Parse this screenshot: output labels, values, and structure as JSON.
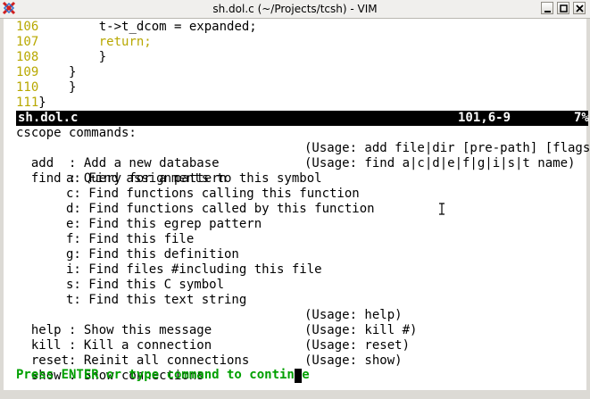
{
  "window": {
    "title": "sh.dol.c (~/Projects/tcsh) - VIM",
    "app_icon": "vim-icon",
    "controls": [
      "minimize-icon",
      "maximize-icon",
      "close-icon"
    ]
  },
  "code_lines": [
    {
      "num": "106",
      "text": "        t->t_dcom = expanded;"
    },
    {
      "num": "107",
      "text": "        return;",
      "keyword": true
    },
    {
      "num": "108",
      "text": "        }"
    },
    {
      "num": "109",
      "text": "    }"
    },
    {
      "num": "110",
      "text": "    }"
    },
    {
      "num": "111",
      "text": "}"
    }
  ],
  "statusline": {
    "filename": "sh.dol.c",
    "position": "101,6-9",
    "percent": "7%"
  },
  "cscope": {
    "header": "cscope commands:",
    "commands": [
      {
        "name": "add  : Add a new database",
        "usage": "(Usage: add file|dir [pre-path] [flags])"
      },
      {
        "name": "find : Query for a pattern",
        "usage": "(Usage: find a|c|d|e|f|g|i|s|t name)"
      }
    ],
    "find_options": [
      "a: Find assignments to this symbol",
      "c: Find functions calling this function",
      "d: Find functions called by this function",
      "e: Find this egrep pattern",
      "f: Find this file",
      "g: Find this definition",
      "i: Find files #including this file",
      "s: Find this C symbol",
      "t: Find this text string"
    ],
    "other_commands": [
      {
        "name": "help : Show this message",
        "usage": "(Usage: help)"
      },
      {
        "name": "kill : Kill a connection",
        "usage": "(Usage: kill #)"
      },
      {
        "name": "reset: Reinit all connections",
        "usage": "(Usage: reset)"
      },
      {
        "name": "show : Show connections",
        "usage": "(Usage: show)"
      }
    ]
  },
  "prompt": "Press ENTER or type command to continue",
  "colors": {
    "line_number": "#b8a800",
    "keyword": "#b8a800",
    "prompt": "#00a000",
    "statusline_bg": "#000000"
  }
}
